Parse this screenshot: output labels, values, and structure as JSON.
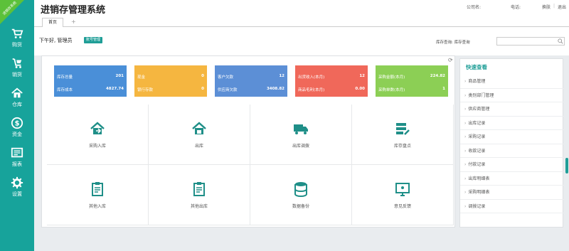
{
  "corner_badge": "进销存系统",
  "app_title": "进销存管理系统",
  "header": {
    "fields": [
      "公司名:",
      "电话:"
    ],
    "links": [
      "换肤",
      "退出"
    ]
  },
  "tabs": {
    "active": "首页"
  },
  "greeting": "下午好, 管理员",
  "role_badge": "账号管理",
  "search": {
    "label": "库存查询: 库存查询",
    "placeholder": ""
  },
  "sidebar": [
    {
      "label": "购货",
      "icon": "cart-icon"
    },
    {
      "label": "销货",
      "icon": "cart-out-icon"
    },
    {
      "label": "仓库",
      "icon": "home-icon"
    },
    {
      "label": "资金",
      "icon": "dollar-icon"
    },
    {
      "label": "报表",
      "icon": "report-icon"
    },
    {
      "label": "设置",
      "icon": "gear-icon"
    }
  ],
  "stat_cards": [
    {
      "color": "#4a8fd8",
      "row1_label": "库存总量",
      "row1_value": "201",
      "row2_label": "库存成本",
      "row2_value": "4827.74"
    },
    {
      "color": "#f5b640",
      "row1_label": "现金",
      "row1_value": "0",
      "row2_label": "银行存款",
      "row2_value": "0"
    },
    {
      "color": "#5c8fd6",
      "row1_label": "客户欠款",
      "row1_value": "12",
      "row2_label": "供应商欠款",
      "row2_value": "3408.82"
    },
    {
      "color": "#f0685a",
      "row1_label": "出货收入(本月)",
      "row1_value": "12",
      "row2_label": "商品毛利(本月)",
      "row2_value": "0.00"
    },
    {
      "color": "#8ccf55",
      "row1_label": "采购金额(本月)",
      "row1_value": "224.82",
      "row2_label": "采购单数(本月)",
      "row2_value": "1"
    }
  ],
  "shortcuts": [
    {
      "label": "采购入库",
      "icon": "truck-in-icon"
    },
    {
      "label": "出库",
      "icon": "warehouse-out-icon"
    },
    {
      "label": "出库调拨",
      "icon": "delivery-truck-icon"
    },
    {
      "label": "库存盘点",
      "icon": "inventory-check-icon"
    },
    {
      "label": "其他入库",
      "icon": "clipboard-in-icon"
    },
    {
      "label": "其他出库",
      "icon": "clipboard-out-icon"
    },
    {
      "label": "数据备份",
      "icon": "database-icon"
    },
    {
      "label": "意见反馈",
      "icon": "monitor-icon"
    }
  ],
  "quick": {
    "title": "快速查看",
    "items": [
      "商品管理",
      "类别部门管理",
      "供应商管理",
      "出库记录",
      "采购记录",
      "收款记录",
      "付款记录",
      "出库明细表",
      "采购明细表",
      "调拨记录"
    ]
  }
}
